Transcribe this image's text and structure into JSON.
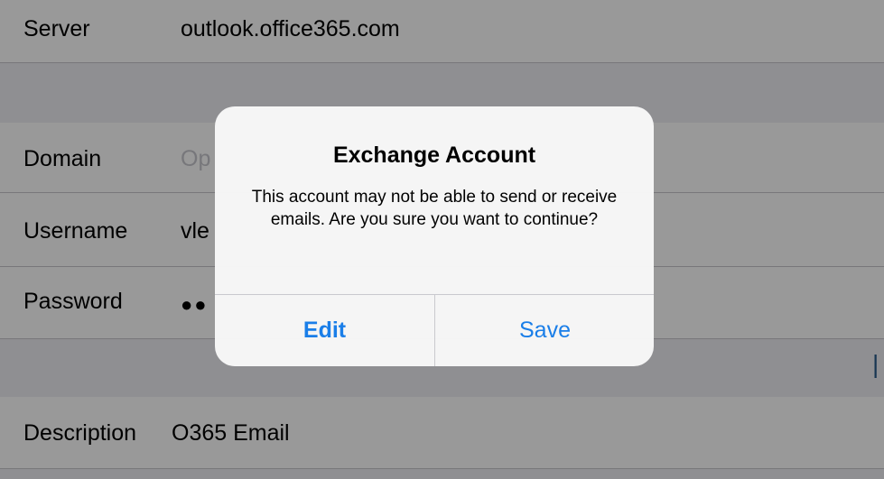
{
  "form": {
    "server": {
      "label": "Server",
      "value": "outlook.office365.com"
    },
    "domain": {
      "label": "Domain",
      "placeholder": "Op"
    },
    "username": {
      "label": "Username",
      "value": "vle"
    },
    "password": {
      "label": "Password",
      "value": "●●"
    },
    "description": {
      "label": "Description",
      "value": "O365 Email"
    }
  },
  "alert": {
    "title": "Exchange Account",
    "message": "This account may not be able to send or receive emails. Are you sure you want to continue?",
    "edit_label": "Edit",
    "save_label": "Save"
  },
  "colors": {
    "accent": "#1a7ee8",
    "background": "#efeff4",
    "separator": "#c8c7cc"
  }
}
